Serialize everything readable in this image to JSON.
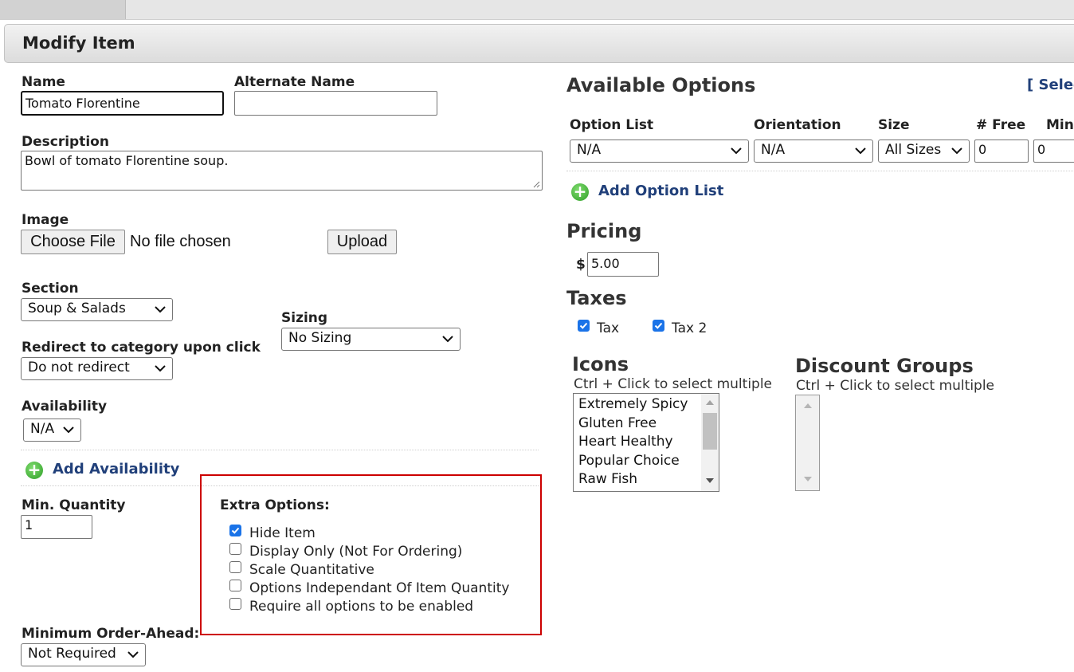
{
  "panel": {
    "title": "Modify Item"
  },
  "left": {
    "name": {
      "label": "Name",
      "value": "Tomato Florentine"
    },
    "alternate_name": {
      "label": "Alternate Name",
      "value": ""
    },
    "description": {
      "label": "Description",
      "value": "Bowl of tomato Florentine soup."
    },
    "image": {
      "label": "Image",
      "choose_file": "Choose File",
      "no_file": "No file chosen",
      "upload": "Upload"
    },
    "section": {
      "label": "Section",
      "value": "Soup & Salads"
    },
    "sizing": {
      "label": "Sizing",
      "value": "No Sizing"
    },
    "redirect": {
      "label": "Redirect to category upon click",
      "value": "Do not redirect"
    },
    "availability": {
      "label": "Availability",
      "value": "N/A",
      "add_label": "Add Availability"
    },
    "min_quantity": {
      "label": "Min. Quantity",
      "value": "1"
    },
    "min_order_ahead": {
      "label": "Minimum Order-Ahead:",
      "value": "Not Required"
    },
    "extra_options": {
      "title": "Extra Options:",
      "items": [
        {
          "label": "Hide Item",
          "checked": true
        },
        {
          "label": "Display Only (Not For Ordering)",
          "checked": false
        },
        {
          "label": "Scale Quantitative",
          "checked": false
        },
        {
          "label": "Options Independant Of Item Quantity",
          "checked": false
        },
        {
          "label": "Require all options to be enabled",
          "checked": false
        }
      ],
      "highlight_color": "#cc0000"
    }
  },
  "right": {
    "available_options": {
      "title": "Available Options",
      "select_link": "[ Selec",
      "columns": {
        "option_list": "Option List",
        "orientation": "Orientation",
        "size": "Size",
        "free": "# Free",
        "min": "Min"
      },
      "row": {
        "option_list": "N/A",
        "orientation": "N/A",
        "size": "All Sizes",
        "free": "0",
        "min": "0"
      },
      "add_label": "Add Option List"
    },
    "pricing": {
      "title": "Pricing",
      "currency": "$",
      "value": "5.00"
    },
    "taxes": {
      "title": "Taxes",
      "items": [
        {
          "label": "Tax",
          "checked": true
        },
        {
          "label": "Tax 2",
          "checked": true
        }
      ]
    },
    "icons": {
      "title": "Icons",
      "hint": "Ctrl + Click to select multiple",
      "items": [
        "Extremely Spicy",
        "Gluten Free",
        "Heart Healthy",
        "Popular Choice",
        "Raw Fish"
      ]
    },
    "discount_groups": {
      "title": "Discount Groups",
      "hint": "Ctrl + Click to select multiple",
      "items": []
    }
  },
  "colors": {
    "link": "#21407a",
    "checkbox_checked": "#1a73e8",
    "add_icon": "#2f9e28"
  }
}
